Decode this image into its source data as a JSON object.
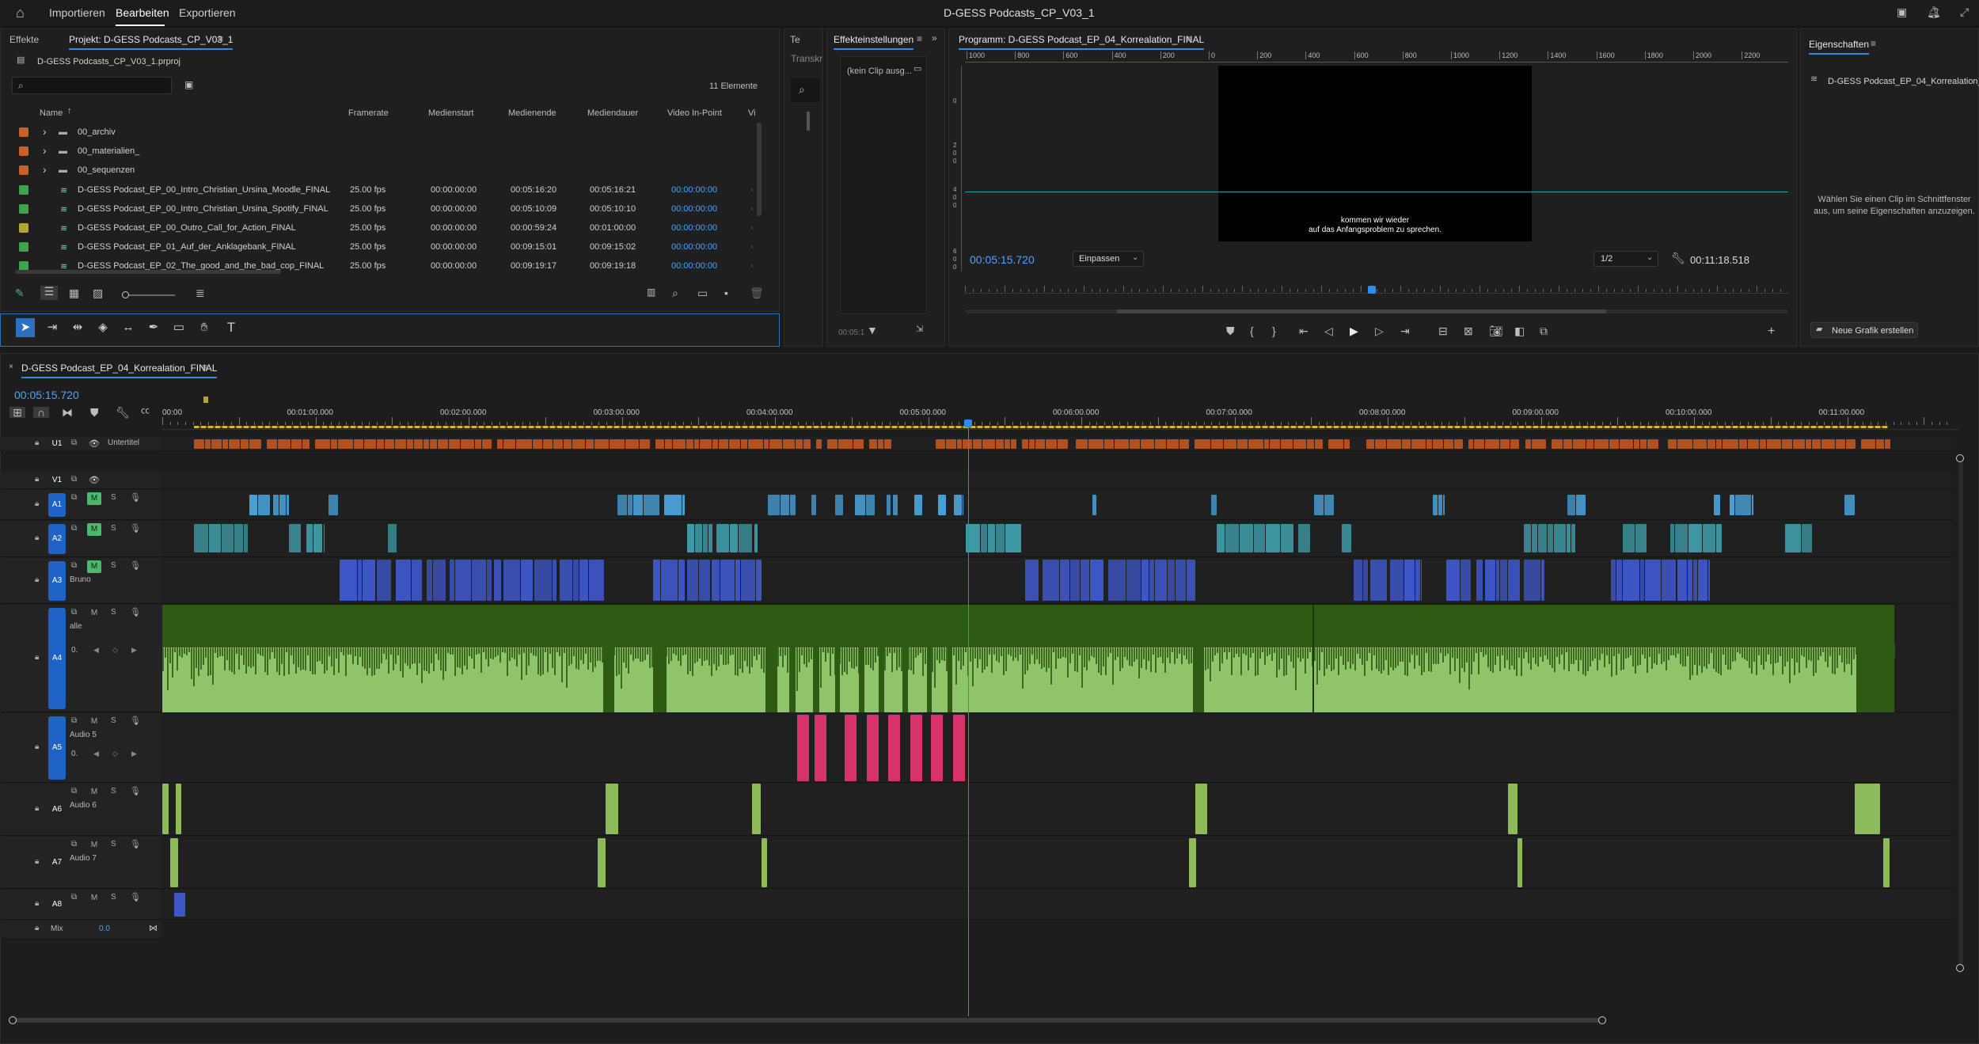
{
  "app": {
    "title": "D-GESS Podcasts_CP_V03_1",
    "menu": [
      "Importieren",
      "Bearbeiten",
      "Exportieren"
    ]
  },
  "project_panel": {
    "tab_effects": "Effekte",
    "tab_project": "Projekt: D-GESS Podcasts_CP_V03_1",
    "file": "D-GESS Podcasts_CP_V03_1.prproj",
    "item_count": "11 Elemente",
    "columns": [
      "Name",
      "Framerate",
      "Medienstart",
      "Medienende",
      "Mediendauer",
      "Video In-Point",
      "Vi"
    ],
    "rows": [
      {
        "name": "00_archiv",
        "type": "folder",
        "color": "#c8602a"
      },
      {
        "name": "00_materialien_",
        "type": "folder",
        "color": "#c8602a"
      },
      {
        "name": "00_sequenzen",
        "type": "folder",
        "color": "#c8602a"
      },
      {
        "name": "D-GESS Podcast_EP_00_Intro_Christian_Ursina_Moodle_FINAL",
        "type": "seq",
        "color": "#3fa34d",
        "fps": "25.00 fps",
        "start": "00:00:00:00",
        "end": "00:05:16:20",
        "dur": "00:05:16:21",
        "in": "00:00:00:00"
      },
      {
        "name": "D-GESS Podcast_EP_00_Intro_Christian_Ursina_Spotify_FINAL",
        "type": "seq",
        "color": "#3fa34d",
        "fps": "25.00 fps",
        "start": "00:00:00:00",
        "end": "00:05:10:09",
        "dur": "00:05:10:10",
        "in": "00:00:00:00"
      },
      {
        "name": "D-GESS Podcast_EP_00_Outro_Call_for_Action_FINAL",
        "type": "seq",
        "color": "#b5a531",
        "fps": "25.00 fps",
        "start": "00:00:00:00",
        "end": "00:00:59:24",
        "dur": "00:01:00:00",
        "in": "00:00:00:00"
      },
      {
        "name": "D-GESS Podcast_EP_01_Auf_der_Anklagebank_FINAL",
        "type": "seq",
        "color": "#3fa34d",
        "fps": "25.00 fps",
        "start": "00:00:00:00",
        "end": "00:09:15:01",
        "dur": "00:09:15:02",
        "in": "00:00:00:00"
      },
      {
        "name": "D-GESS Podcast_EP_02_The_good_and_the_bad_cop_FINAL",
        "type": "seq",
        "color": "#3fa34d",
        "fps": "25.00 fps",
        "start": "00:00:00:00",
        "end": "00:09:19:17",
        "dur": "00:09:19:18",
        "in": "00:00:00:00"
      }
    ]
  },
  "mini_panel": {
    "tab1": "Te",
    "tab2": "Transkr"
  },
  "effect_panel": {
    "tab": "Effekteinstellungen",
    "no_clip": "(kein Clip ausg...",
    "time": "00:05:1"
  },
  "program_monitor": {
    "tab": "Programm: D-GESS Podcast_EP_04_Korrealation_FINAL",
    "ruler": [
      "1000",
      "800",
      "600",
      "400",
      "200",
      "0",
      "200",
      "400",
      "600",
      "800",
      "1000",
      "1200",
      "1400",
      "1600",
      "1800",
      "2000",
      "2200"
    ],
    "vruler": [
      "0",
      "2 0 0",
      "4 0 0",
      "6 0 0"
    ],
    "subtitle_line1": "kommen wir wieder",
    "subtitle_line2": "auf das Anfangsproblem zu sprechen.",
    "timecode": "00:05:15.720",
    "fit": "Einpassen",
    "resolution": "1/2",
    "duration": "00:11:18.518"
  },
  "properties_panel": {
    "tab": "Eigenschaften",
    "sequence": "D-GESS Podcast_EP_04_Korrealation_",
    "hint": "Wählen Sie einen Clip im Schnittfenster aus, um seine Eigenschaften anzuzeigen.",
    "new_graphic": "Neue Grafik erstellen"
  },
  "timeline": {
    "tab": "D-GESS Podcast_EP_04_Korrealation_FINAL",
    "timecode": "00:05:15.720",
    "ruler": [
      "00:00",
      "00:01:00.000",
      "00:02:00.000",
      "00:03:00.000",
      "00:04:00.000",
      "00:05:00.000",
      "00:06:00.000",
      "00:07:00.000",
      "00:08:00.000",
      "00:09:00.000",
      "00:10:00.000",
      "00:11:00.000"
    ],
    "playhead_seconds": 315.72,
    "tracks": [
      {
        "id": "U1",
        "name": "Untertitel"
      },
      {
        "id": "V1",
        "name": ""
      },
      {
        "id": "A1",
        "name": ""
      },
      {
        "id": "A2",
        "name": ""
      },
      {
        "id": "A3",
        "name": "Bruno"
      },
      {
        "id": "A4",
        "name": "alle"
      },
      {
        "id": "A5",
        "name": "Audio 5"
      },
      {
        "id": "A6",
        "name": "Audio 6"
      },
      {
        "id": "A7",
        "name": "Audio 7"
      },
      {
        "id": "A8",
        "name": ""
      }
    ],
    "mix_label": "Mix",
    "mix_value": "0.0",
    "m_label": "M",
    "s_label": "S"
  },
  "colors": {
    "accent": "#2d8ceb",
    "subtitle_clip": "#b3501e",
    "a1_clip": "#4aa0d6",
    "a2_clip": "#3e9aa6",
    "a3_clip": "#3e57c8",
    "a4_clip": "#8fc46a",
    "a5_clip": "#d6336c",
    "a6_clip": "#8dbb5a"
  }
}
